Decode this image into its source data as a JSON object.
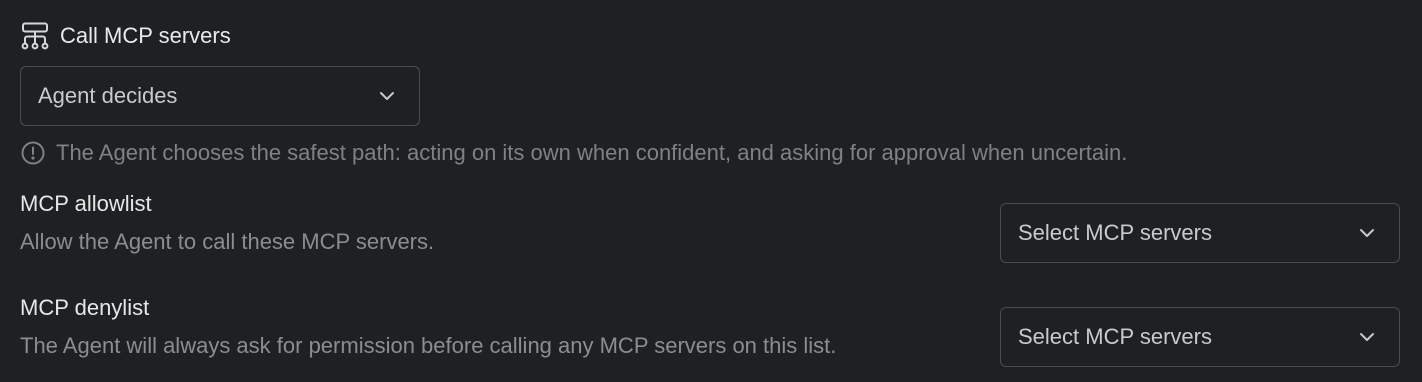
{
  "call_mcp": {
    "title": "Call MCP servers",
    "icon": "sitemap-icon",
    "mode_value": "Agent decides",
    "hint": "The Agent chooses the safest path: acting on its own when confident, and asking for approval when uncertain.",
    "hint_icon": "info-circle-icon"
  },
  "allowlist": {
    "label": "MCP allowlist",
    "description": "Allow the Agent to call these MCP servers.",
    "placeholder": "Select MCP servers"
  },
  "denylist": {
    "label": "MCP denylist",
    "description": "The Agent will always ask for permission before calling any MCP servers on this list.",
    "placeholder": "Select MCP servers"
  },
  "colors": {
    "background": "#1f2022",
    "border": "#4a4c50",
    "text_primary": "#e6e7e8",
    "text_secondary": "#8b8d91"
  }
}
